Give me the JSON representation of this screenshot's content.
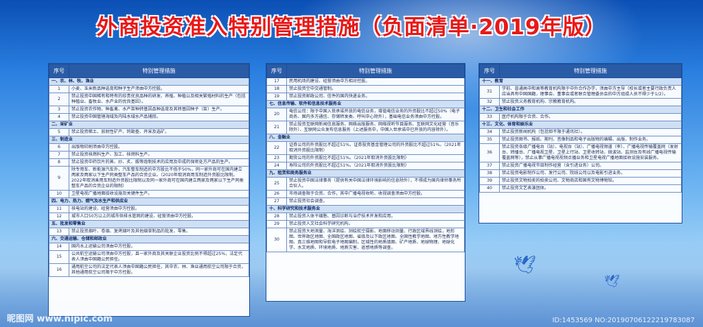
{
  "title": "外商投资准入特别管理措施（负面清单·2019年版）",
  "header": {
    "no": "序号",
    "measure": "特别管理措施"
  },
  "panels": [
    {
      "rows": [
        {
          "type": "sec",
          "text": "一、农、林、牧、渔业"
        },
        {
          "no": "1",
          "text": "小麦、玉米新品种选育和种子生产须由中方控股。"
        },
        {
          "no": "2",
          "text": "禁止投资中国稀有和特有的珍贵优良品种的研发、养殖、种植以及相关繁殖材料的生产（包括种植业、畜牧业、水产业的优良基因）。"
        },
        {
          "no": "3",
          "text": "禁止投资农作物、种畜禽、水产苗种转基因品种选育及其转基因种子（苗）生产。"
        },
        {
          "no": "4",
          "text": "禁止投资中国管辖海域及内陆水域水产品捕捞。"
        },
        {
          "type": "sec",
          "text": "二、采矿业"
        },
        {
          "no": "5",
          "text": "禁止投资稀土、放射性矿产、钨勘查、开采及选矿。"
        },
        {
          "type": "sec",
          "text": "三、制造业"
        },
        {
          "no": "6",
          "text": "出版物印刷须由中方控股。"
        },
        {
          "no": "7",
          "text": "禁止投资核燃料生产、加工、核燃料生产。"
        },
        {
          "no": "8",
          "text": "禁止投资中药饮片的蒸、炒、炙、煅等炮制技术的应用及中成药保密处方产品的生产。"
        },
        {
          "no": "9",
          "text": "除专用车、新能源汽车外，汽车整车制造的中方股比不低于50%，同一家外商可在国内建立两家及两家以下生产同类整车产品的合资企业。（2020年取消商用车制造外资股比限制。2022年取消乘用车制造外资股比限制以及同一家外商可在国内建立两家及两家以下生产同类整车产品的合资企业的限制）"
        },
        {
          "no": "10",
          "text": "卫星电视广播地面接收设施及关键件生产。"
        },
        {
          "type": "sec",
          "text": "四、电力、热力、燃气及水生产和供应业"
        },
        {
          "no": "11",
          "text": "核电站的建设、经营须由中方控股。"
        },
        {
          "no": "12",
          "text": "城市人口50万以上的城市供排水管网的建设、经营须由中方控股。"
        },
        {
          "type": "sec",
          "text": "五、批发和零售业"
        },
        {
          "no": "13",
          "text": "禁止投资烟叶、卷烟、复烤烟叶及其他烟草制品的批发、零售。"
        },
        {
          "type": "sec",
          "text": "六、交通运输、仓储和邮政业"
        },
        {
          "no": "14",
          "text": "国内水上运输公司须由中方控股。"
        },
        {
          "no": "15",
          "text": "公共航空运输公司须由中方控股，且一家外商及其关联企业投资比例不得超过25%，法定代表人须由中国籍公民担任。"
        },
        {
          "no": "16",
          "text": "通用航空公司的法定代表人须由中国籍公民担任，其中农、林、渔业通用航空公司限于合资，其他通用航空公司限于中方控股。"
        }
      ]
    },
    {
      "rows": [
        {
          "no": "17",
          "text": "民用机场的建设、经营须由中方相对控股。"
        },
        {
          "no": "18",
          "text": "禁止投资空中交通管制。"
        },
        {
          "no": "19",
          "text": "禁止投资邮政公司、信件的国内快递业务。"
        },
        {
          "type": "sec",
          "text": "七、信息传输、软件和信息技术服务业"
        },
        {
          "no": "20",
          "text": "电信公司：限于中国入世承诺开放的电信业务，增值电信业务的外资股比不超过50%（电子商务、国内多方通信、存储转发类、呼叫中心除外），基础电信业务须由中方控股。"
        },
        {
          "no": "21",
          "text": "禁止投资互联网新闻信息服务、网络出版服务、网络视听节目服务、互联网文化经营（音乐除外）、互联网公众发布信息服务（上述服务中，中国入世承诺中已开放的内容除外）。"
        },
        {
          "type": "sec",
          "text": "八、金融业"
        },
        {
          "no": "22",
          "text": "证券公司的外资股比不超过51%，证券投资基金管理公司的外资股比不超过51%。（2021年取消外资股比限制）"
        },
        {
          "no": "23",
          "text": "期货公司的外资股比不超过51%。（2021年取消外资股比限制）"
        },
        {
          "no": "24",
          "text": "寿险公司的外资股比不超过51%。（2021年取消外资股比限制）"
        },
        {
          "type": "sec",
          "text": "九、租赁和商务服务业"
        },
        {
          "no": "25",
          "text": "禁止投资中国法律事务（提供有关中国法律环境影响的信息除外），不得成为国内律师事务所合伙人。"
        },
        {
          "no": "26",
          "text": "市场调查限于合资、合作，其中广播电视收听、收视调查须由中方控股。"
        },
        {
          "no": "27",
          "text": "禁止投资社会调查。"
        },
        {
          "type": "sec",
          "text": "十、科学研究和技术服务业"
        },
        {
          "no": "28",
          "text": "禁止投资人体干细胞、基因诊断与治疗技术开发和应用。"
        },
        {
          "no": "29",
          "text": "禁止投资人文社会科学研究机构。"
        },
        {
          "no": "30",
          "text": "禁止投资大地测量、海洋测绘、测绘航空摄影、地面移动测量、行政区域界线测绘，地形图、世界政区地图、全国政区地图、省级及以下政区地图、全国性教学地图、地方性教学地图、真三维地图和导航电子地图编制，区域性的地质填图、矿产地质、地球物理、地球化学、水文地质、环境地质、地质灾害、遥感地质等调查。"
        }
      ]
    },
    {
      "rows": [
        {
          "type": "sec",
          "text": "十一、教育"
        },
        {
          "no": "31",
          "text": "学前、普通高中和高等教育机构限于中外合作办学，须由中方主导（校长或者主要行政负责人应当具有中国国籍，理事会、董事会或者联合管理委员会的中方组成人员不得少于1/2）。"
        },
        {
          "no": "32",
          "text": "禁止投资义务教育机构、宗教教育机构。"
        },
        {
          "type": "sec",
          "text": "十二、卫生和社会工作"
        },
        {
          "no": "33",
          "text": "医疗机构限于合资、合作。"
        },
        {
          "type": "sec",
          "text": "十三、文化、体育和娱乐业"
        },
        {
          "no": "34",
          "text": "禁止投资新闻机构（包括但不限于通讯社）。"
        },
        {
          "no": "35",
          "text": "禁止投资图书、报纸、期刊、音像制品和电子出版物的编辑、出版、制作业务。"
        },
        {
          "no": "36",
          "text": "禁止投资各级广播电台（站）、电视台（站）、广播电视频道（率）、广播电视传输覆盖网（发射台、转播台、广播电视卫星、卫星上行站、卫星收转站、微波站、监测台及有线广播电视传输覆盖网等），禁止从事广播电视视频点播业务和卫星电视广播地面接收设施安装服务。"
        },
        {
          "no": "37",
          "text": "禁止投资广播电视节目制作经营（含引进业务）公司。"
        },
        {
          "no": "38",
          "text": "禁止投资电影制作公司、发行公司、院线公司以及电影引进业务。"
        },
        {
          "no": "39",
          "text": "禁止投资文物拍卖的拍卖公司、文物商店和国有文物博物馆。"
        },
        {
          "no": "40",
          "text": "禁止投资文艺表演团体。"
        }
      ]
    }
  ],
  "watermark": {
    "left": "昵图网 www.nipic.com",
    "right": "ID:1453569 NO:20190706122219783087"
  }
}
